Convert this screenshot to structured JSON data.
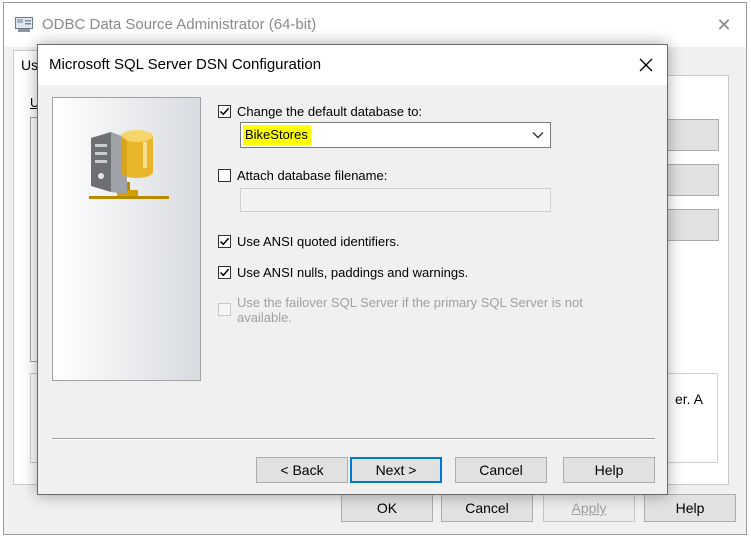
{
  "background_window": {
    "title": "ODBC Data Source Administrator (64-bit)",
    "tab_label": "Us",
    "underlined_label": "U",
    "groupbox_text": "er.  A",
    "buttons": {
      "ok": "OK",
      "cancel": "Cancel",
      "apply": "Apply",
      "help": "Help"
    }
  },
  "dialog": {
    "title": "Microsoft SQL Server DSN Configuration",
    "change_db": {
      "label": "Change the default database to:",
      "checked": true
    },
    "database_combo": {
      "value": "BikeStores",
      "highlight_color": "#ffff00"
    },
    "attach_db": {
      "label": "Attach database filename:",
      "checked": false,
      "value": ""
    },
    "ansi_quoted": {
      "label": "Use ANSI quoted identifiers.",
      "checked": true
    },
    "ansi_nulls": {
      "label": "Use ANSI nulls, paddings and warnings.",
      "checked": true
    },
    "failover": {
      "label": "Use the failover SQL Server if the primary SQL Server is not available.",
      "checked": false,
      "enabled": false
    },
    "buttons": {
      "back": "< Back",
      "next": "Next >",
      "cancel": "Cancel",
      "help": "Help"
    }
  },
  "colors": {
    "accent": "#0078d7",
    "window_bg": "#f0f0f0",
    "button_face": "#e1e1e1"
  },
  "icons": [
    "odbc-app-icon",
    "close-icon",
    "sql-server-icon",
    "check-icon",
    "chevron-down-icon"
  ]
}
